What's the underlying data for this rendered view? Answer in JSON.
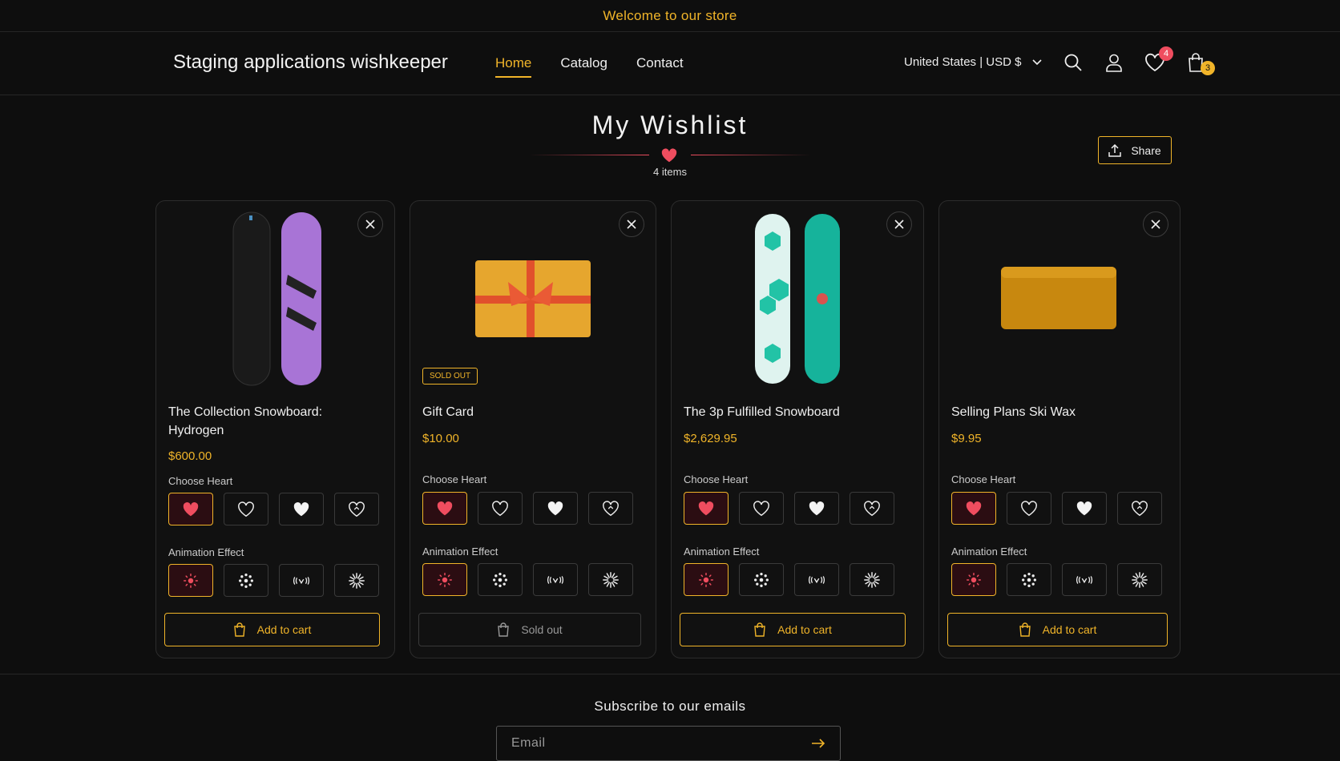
{
  "announcement": "Welcome to our store",
  "header": {
    "logo": "Staging applications wishkeeper",
    "nav": [
      "Home",
      "Catalog",
      "Contact"
    ],
    "locale": "United States | USD $",
    "wishlist_count": "4",
    "cart_count": "3"
  },
  "page": {
    "title": "My Wishlist",
    "count": "4 items",
    "share_label": "Share"
  },
  "products": [
    {
      "name": "The Collection Snowboard: Hydrogen",
      "price": "$600.00",
      "sold_out": false,
      "button": "Add to cart"
    },
    {
      "name": "Gift Card",
      "price": "$10.00",
      "sold_out": true,
      "badge": "SOLD OUT",
      "button": "Sold out"
    },
    {
      "name": "The 3p Fulfilled Snowboard",
      "price": "$2,629.95",
      "sold_out": false,
      "button": "Add to cart"
    },
    {
      "name": "Selling Plans Ski Wax",
      "price": "$9.95",
      "sold_out": false,
      "button": "Add to cart"
    }
  ],
  "labels": {
    "choose_heart": "Choose Heart",
    "animation_effect": "Animation Effect"
  },
  "colors": {
    "accent": "#f0b429",
    "heart": "#ef4d5f"
  },
  "footer": {
    "subscribe_title": "Subscribe to our emails",
    "email_placeholder": "Email"
  }
}
